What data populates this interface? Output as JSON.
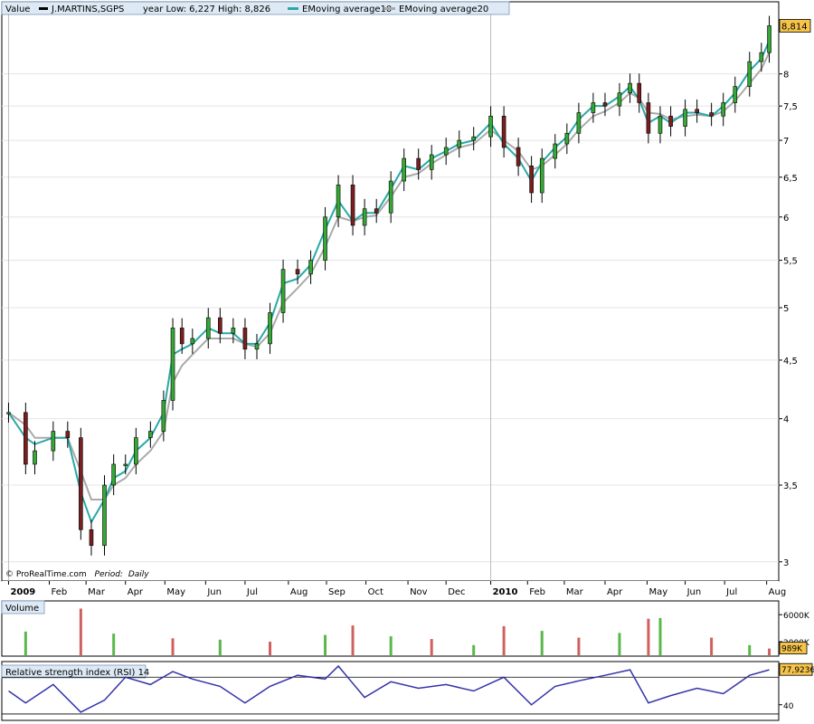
{
  "header": {
    "value_label": "Value",
    "instrument_name": "J.MARTINS,SGPS",
    "year_range": "year Low: 6,227  High: 8,826",
    "ema10_label": "EMoving average10",
    "ema20_label": "EMoving average20"
  },
  "footer": {
    "copyright": "© ProRealTime.com",
    "period_label": "Period:",
    "period_value": "Daily"
  },
  "colors": {
    "frame": "#000000",
    "grid": "#e4e4e4",
    "candle_outline": "#000000",
    "candle_up": "#35a835",
    "candle_down": "#7a1f1f",
    "ema10": "#2aa8a8",
    "ema20": "#aaaaaa",
    "vol_up": "#59b84a",
    "vol_down": "#d06060",
    "rsi_line": "#3333aa",
    "last_price_bg": "#f6c44a",
    "header_bg": "#dde9f4"
  },
  "chart_data": {
    "type": "line",
    "title": "J.MARTINS,SGPS",
    "price_axis": {
      "ticks": [
        3,
        3.5,
        4,
        4.5,
        5,
        5.5,
        6,
        6.5,
        7,
        7.5,
        8
      ],
      "tick_labels": [
        "3",
        "3,5",
        "4",
        "4,5",
        "5",
        "5,5",
        "6",
        "6,5",
        "7",
        "7,5",
        "8"
      ],
      "range": [
        2.95,
        8.95
      ],
      "scale": "log",
      "last_value": 8.814,
      "last_value_label": "8,814"
    },
    "time_axis": {
      "labels": [
        "2009",
        "Feb",
        "Mar",
        "Apr",
        "May",
        "Jun",
        "Jul",
        "Aug",
        "Sep",
        "Oct",
        "Nov",
        "Dec",
        "2010",
        "Feb",
        "Mar",
        "Apr",
        "May",
        "Jun",
        "Jul",
        "Aug"
      ],
      "bold_labels": [
        "2009",
        "2010"
      ],
      "dates": [
        "2009-01-02",
        "2009-02-02",
        "2009-03-02",
        "2009-04-01",
        "2009-05-01",
        "2009-06-01",
        "2009-07-01",
        "2009-08-03",
        "2009-09-01",
        "2009-10-01",
        "2009-11-02",
        "2009-12-01",
        "2010-01-04",
        "2010-02-01",
        "2010-03-01",
        "2010-04-01",
        "2010-05-03",
        "2010-06-01",
        "2010-07-01",
        "2010-08-02"
      ]
    },
    "series": [
      {
        "name": "J.MARTINS,SGPS",
        "kind": "candlestick",
        "x": [
          "2009-01-02",
          "2009-01-15",
          "2009-01-22",
          "2009-02-05",
          "2009-02-16",
          "2009-02-26",
          "2009-03-06",
          "2009-03-16",
          "2009-03-23",
          "2009-04-01",
          "2009-04-09",
          "2009-04-20",
          "2009-04-30",
          "2009-05-07",
          "2009-05-14",
          "2009-05-22",
          "2009-06-03",
          "2009-06-12",
          "2009-06-22",
          "2009-07-01",
          "2009-07-10",
          "2009-07-20",
          "2009-07-30",
          "2009-08-10",
          "2009-08-20",
          "2009-08-31",
          "2009-09-10",
          "2009-09-21",
          "2009-09-30",
          "2009-10-09",
          "2009-10-20",
          "2009-10-30",
          "2009-11-10",
          "2009-11-20",
          "2009-12-01",
          "2009-12-11",
          "2009-12-22",
          "2010-01-04",
          "2010-01-14",
          "2010-01-25",
          "2010-02-04",
          "2010-02-12",
          "2010-02-22",
          "2010-03-03",
          "2010-03-12",
          "2010-03-23",
          "2010-04-01",
          "2010-04-12",
          "2010-04-20",
          "2010-04-27",
          "2010-05-04",
          "2010-05-13",
          "2010-05-21",
          "2010-06-01",
          "2010-06-10",
          "2010-06-21",
          "2010-06-30",
          "2010-07-09",
          "2010-07-20",
          "2010-07-29",
          "2010-08-04"
        ],
        "close": [
          4.05,
          3.65,
          3.75,
          3.9,
          3.85,
          3.2,
          3.1,
          3.5,
          3.65,
          3.65,
          3.85,
          3.9,
          4.15,
          4.8,
          4.65,
          4.7,
          4.9,
          4.75,
          4.8,
          4.6,
          4.65,
          4.95,
          5.4,
          5.35,
          5.5,
          6.0,
          6.4,
          5.9,
          6.1,
          6.05,
          6.45,
          6.75,
          6.6,
          6.8,
          6.9,
          7.0,
          7.05,
          7.35,
          6.9,
          6.65,
          6.3,
          6.75,
          6.95,
          7.1,
          7.4,
          7.55,
          7.5,
          7.7,
          7.85,
          7.55,
          7.1,
          7.35,
          7.2,
          7.45,
          7.4,
          7.35,
          7.55,
          7.8,
          8.2,
          8.35,
          8.814
        ]
      },
      {
        "name": "EMoving average10",
        "x": [
          "2009-01-02",
          "2009-01-15",
          "2009-01-22",
          "2009-02-05",
          "2009-02-16",
          "2009-02-26",
          "2009-03-06",
          "2009-03-16",
          "2009-03-23",
          "2009-04-01",
          "2009-04-09",
          "2009-04-20",
          "2009-04-30",
          "2009-05-07",
          "2009-05-14",
          "2009-05-22",
          "2009-06-03",
          "2009-06-12",
          "2009-06-22",
          "2009-07-01",
          "2009-07-10",
          "2009-07-20",
          "2009-07-30",
          "2009-08-10",
          "2009-08-20",
          "2009-08-31",
          "2009-09-10",
          "2009-09-21",
          "2009-09-30",
          "2009-10-09",
          "2009-10-20",
          "2009-10-30",
          "2009-11-10",
          "2009-11-20",
          "2009-12-01",
          "2009-12-11",
          "2009-12-22",
          "2010-01-04",
          "2010-01-14",
          "2010-01-25",
          "2010-02-04",
          "2010-02-12",
          "2010-02-22",
          "2010-03-03",
          "2010-03-12",
          "2010-03-23",
          "2010-04-01",
          "2010-04-12",
          "2010-04-20",
          "2010-04-27",
          "2010-05-04",
          "2010-05-13",
          "2010-05-21",
          "2010-06-01",
          "2010-06-10",
          "2010-06-21",
          "2010-06-30",
          "2010-07-09",
          "2010-07-20",
          "2010-07-29",
          "2010-08-04"
        ],
        "values": [
          4.05,
          3.85,
          3.8,
          3.85,
          3.85,
          3.45,
          3.25,
          3.4,
          3.55,
          3.6,
          3.75,
          3.85,
          4.05,
          4.55,
          4.6,
          4.65,
          4.8,
          4.75,
          4.75,
          4.65,
          4.65,
          4.85,
          5.25,
          5.3,
          5.45,
          5.85,
          6.2,
          5.95,
          6.05,
          6.05,
          6.35,
          6.65,
          6.6,
          6.75,
          6.85,
          6.95,
          7.0,
          7.25,
          6.95,
          6.75,
          6.45,
          6.7,
          6.9,
          7.05,
          7.3,
          7.5,
          7.5,
          7.65,
          7.8,
          7.6,
          7.25,
          7.35,
          7.25,
          7.4,
          7.4,
          7.35,
          7.5,
          7.7,
          8.05,
          8.25,
          8.55
        ]
      },
      {
        "name": "EMoving average20",
        "x": [
          "2009-01-02",
          "2009-01-15",
          "2009-01-22",
          "2009-02-05",
          "2009-02-16",
          "2009-02-26",
          "2009-03-06",
          "2009-03-16",
          "2009-03-23",
          "2009-04-01",
          "2009-04-09",
          "2009-04-20",
          "2009-04-30",
          "2009-05-07",
          "2009-05-14",
          "2009-05-22",
          "2009-06-03",
          "2009-06-12",
          "2009-06-22",
          "2009-07-01",
          "2009-07-10",
          "2009-07-20",
          "2009-07-30",
          "2009-08-10",
          "2009-08-20",
          "2009-08-31",
          "2009-09-10",
          "2009-09-21",
          "2009-09-30",
          "2009-10-09",
          "2009-10-20",
          "2009-10-30",
          "2009-11-10",
          "2009-11-20",
          "2009-12-01",
          "2009-12-11",
          "2009-12-22",
          "2010-01-04",
          "2010-01-14",
          "2010-01-25",
          "2010-02-04",
          "2010-02-12",
          "2010-02-22",
          "2010-03-03",
          "2010-03-12",
          "2010-03-23",
          "2010-04-01",
          "2010-04-12",
          "2010-04-20",
          "2010-04-27",
          "2010-05-04",
          "2010-05-13",
          "2010-05-21",
          "2010-06-01",
          "2010-06-10",
          "2010-06-21",
          "2010-06-30",
          "2010-07-09",
          "2010-07-20",
          "2010-07-29",
          "2010-08-04"
        ],
        "values": [
          4.05,
          3.95,
          3.85,
          3.85,
          3.85,
          3.6,
          3.4,
          3.4,
          3.5,
          3.55,
          3.65,
          3.75,
          3.9,
          4.3,
          4.45,
          4.55,
          4.7,
          4.7,
          4.7,
          4.65,
          4.62,
          4.75,
          5.05,
          5.2,
          5.35,
          5.65,
          6.0,
          5.95,
          6.0,
          6.02,
          6.25,
          6.5,
          6.55,
          6.68,
          6.8,
          6.9,
          6.95,
          7.15,
          7.0,
          6.85,
          6.6,
          6.65,
          6.8,
          6.95,
          7.15,
          7.35,
          7.42,
          7.55,
          7.7,
          7.62,
          7.4,
          7.38,
          7.3,
          7.35,
          7.37,
          7.35,
          7.42,
          7.58,
          7.85,
          8.08,
          8.35
        ]
      }
    ],
    "volume": {
      "title": "Volume",
      "tick_labels": [
        "6000K",
        "2000K"
      ],
      "ticks": [
        6000,
        2000
      ],
      "last_value_label": "989K",
      "last_value": 989,
      "unit": "K",
      "x": [
        "2009-01-15",
        "2009-02-26",
        "2009-03-23",
        "2009-05-07",
        "2009-06-12",
        "2009-07-20",
        "2009-08-31",
        "2009-09-21",
        "2009-10-20",
        "2009-11-20",
        "2009-12-22",
        "2010-01-14",
        "2010-02-12",
        "2010-03-12",
        "2010-04-12",
        "2010-05-04",
        "2010-05-13",
        "2010-06-21",
        "2010-07-20",
        "2010-08-04"
      ],
      "values": [
        3500,
        6900,
        3200,
        2500,
        2300,
        2000,
        3000,
        4400,
        2800,
        2400,
        1500,
        4300,
        3600,
        2600,
        3300,
        5400,
        5500,
        2600,
        1500,
        989
      ]
    },
    "rsi": {
      "title": "Relative strength index (RSI) 14",
      "tick_labels": [
        "40"
      ],
      "ticks": [
        40
      ],
      "last_value_label": "77,9236",
      "last_value": 77.9236,
      "x": [
        "2009-01-02",
        "2009-01-15",
        "2009-02-05",
        "2009-02-26",
        "2009-03-16",
        "2009-04-01",
        "2009-04-20",
        "2009-05-07",
        "2009-05-22",
        "2009-06-12",
        "2009-07-01",
        "2009-07-20",
        "2009-08-10",
        "2009-08-31",
        "2009-09-10",
        "2009-09-30",
        "2009-10-20",
        "2009-11-10",
        "2009-12-01",
        "2009-12-22",
        "2010-01-14",
        "2010-02-04",
        "2010-02-22",
        "2010-03-12",
        "2010-04-01",
        "2010-04-20",
        "2010-05-04",
        "2010-05-21",
        "2010-06-10",
        "2010-06-30",
        "2010-07-20",
        "2010-08-04"
      ],
      "values": [
        55,
        42,
        62,
        32,
        45,
        70,
        62,
        76,
        68,
        60,
        42,
        60,
        72,
        68,
        82,
        48,
        65,
        58,
        62,
        55,
        70,
        40,
        60,
        66,
        72,
        78,
        42,
        50,
        58,
        52,
        72,
        78
      ]
    }
  }
}
